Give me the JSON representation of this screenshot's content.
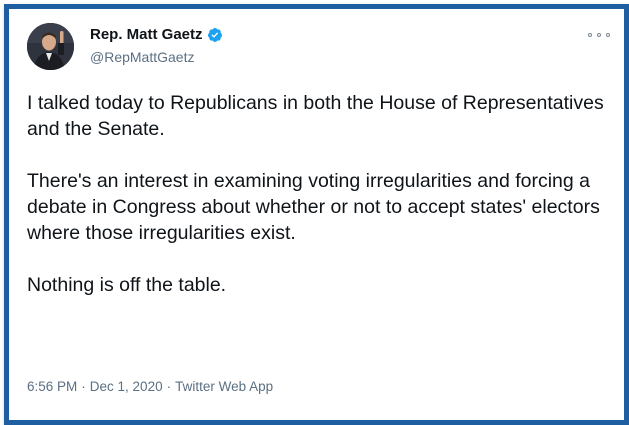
{
  "tweet": {
    "display_name": "Rep. Matt Gaetz",
    "handle": "@RepMattGaetz",
    "verified": true,
    "paragraphs": [
      "I talked today to Republicans in both the House of Representatives and the Senate.",
      "There's an interest in examining voting irregularities and forcing a debate in Congress about whether or not to accept states' electors where those irregularities exist.",
      "Nothing is off the table."
    ],
    "time": "6:56 PM",
    "date": "Dec 1, 2020",
    "source": "Twitter Web App",
    "separator": "·"
  },
  "icons": {
    "verified": "verified-badge-icon",
    "more": "more-options-icon"
  },
  "colors": {
    "frame_border": "#1f5fa1",
    "verified_blue": "#1da1f2",
    "text_primary": "#0f1419",
    "text_secondary": "#5b7083"
  }
}
